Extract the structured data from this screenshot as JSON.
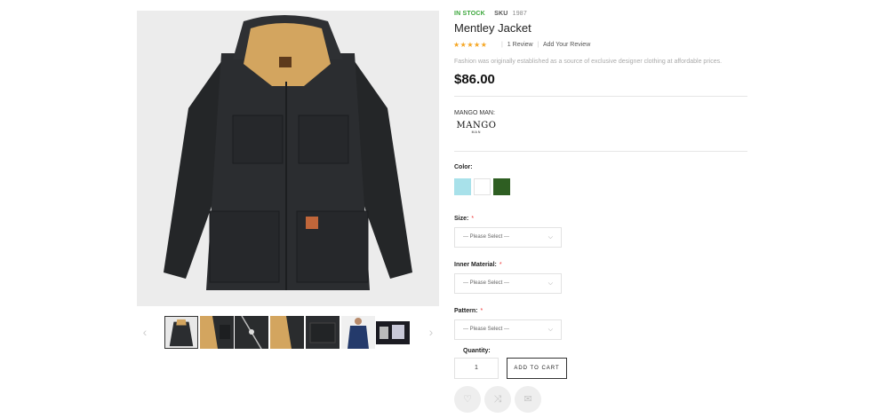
{
  "gallery": {
    "prev_icon": "chevron-left-icon",
    "next_icon": "chevron-right-icon",
    "thumbnails": [
      {
        "name": "jacket-front"
      },
      {
        "name": "fabric-detail"
      },
      {
        "name": "zipper-detail"
      },
      {
        "name": "fur-lining"
      },
      {
        "name": "pocket-detail"
      },
      {
        "name": "model-navy"
      },
      {
        "name": "video-preview"
      }
    ]
  },
  "product": {
    "stock_status": "IN STOCK",
    "sku_label": "SKU",
    "sku_value": "1987",
    "title": "Mentley Jacket",
    "rating": "★★★★★",
    "review_count": "1",
    "review_label": "Review",
    "add_review": "Add Your Review",
    "description": "Fashion was originally established as a source of exclusive designer clothing at affordable prices.",
    "price": "$86.00",
    "brand_label": "MANGO MAN:",
    "brand_logo_word": "MANGO",
    "brand_logo_sub": "MAN"
  },
  "options": {
    "color_label": "Color:",
    "colors": [
      "#a8e1ea",
      "#ffffff",
      "#2e5e22"
    ],
    "size_label": "Size:",
    "inner_label": "Inner Material:",
    "pattern_label": "Pattern:",
    "required_mark": "*",
    "select_placeholder": "--- Please Select ---"
  },
  "purchase": {
    "quantity_label": "Quantity:",
    "quantity_value": "1",
    "add_to_cart": "ADD TO CART",
    "wishlist_icon": "heart-icon",
    "compare_icon": "shuffle-icon",
    "email_icon": "envelope-icon"
  }
}
